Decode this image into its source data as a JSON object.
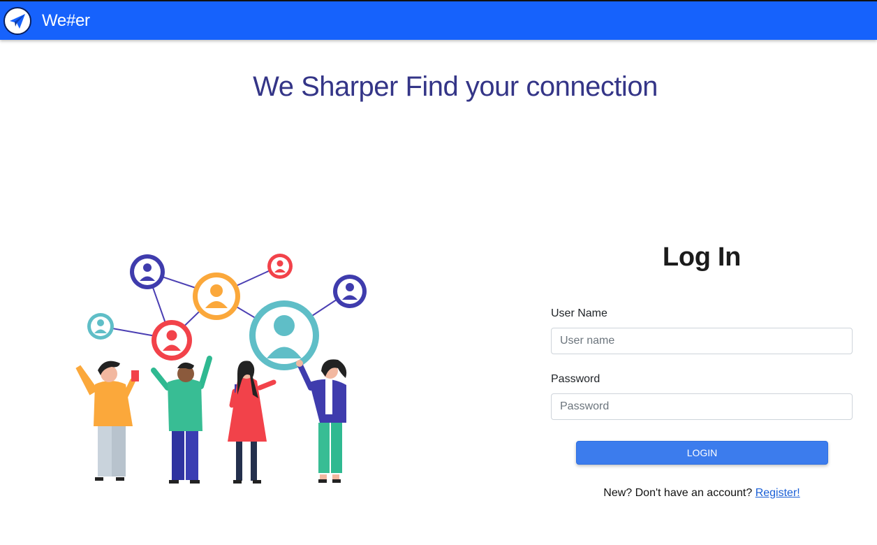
{
  "navbar": {
    "brand": "We#er",
    "logo_icon": "paper-plane-icon",
    "color": "#1662fc"
  },
  "hero": {
    "tagline": "We Sharper Find your connection",
    "tagline_color": "#343587",
    "illustration": "people-network-illustration"
  },
  "login": {
    "title": "Log In",
    "username_label": "User Name",
    "username_placeholder": "User name",
    "username_value": "",
    "password_label": "Password",
    "password_placeholder": "Password",
    "password_value": "",
    "button_label": "LOGIN",
    "button_color": "#3c7ced",
    "register_prompt": "New? Don't have an account?",
    "register_link": "Register!"
  }
}
